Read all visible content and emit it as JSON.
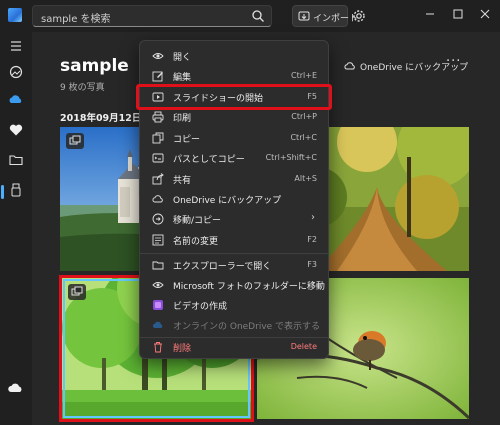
{
  "search": {
    "value": "sample を検索"
  },
  "toolbar": {
    "import_label": "インポート"
  },
  "album": {
    "title": "sample",
    "count": "9 枚の写真",
    "onedrive_label": "OneDrive にバックアップ",
    "more_label": "···",
    "date": "2018年09月12日"
  },
  "menu": {
    "items": [
      {
        "label": "開く",
        "shortcut": "",
        "icon": "eye-icon"
      },
      {
        "label": "編集",
        "shortcut": "Ctrl+E",
        "icon": "edit-icon"
      },
      {
        "label": "スライドショーの開始",
        "shortcut": "F5",
        "icon": "slideshow-icon"
      },
      {
        "label": "印刷",
        "shortcut": "Ctrl+P",
        "icon": "print-icon"
      },
      {
        "label": "コピー",
        "shortcut": "Ctrl+C",
        "icon": "copy-icon"
      },
      {
        "label": "パスとしてコピー",
        "shortcut": "Ctrl+Shift+C",
        "icon": "copy-path-icon"
      },
      {
        "label": "共有",
        "shortcut": "Alt+S",
        "icon": "share-icon"
      },
      {
        "label": "OneDrive にバックアップ",
        "shortcut": "",
        "icon": "onedrive-icon"
      },
      {
        "label": "移動/コピー",
        "shortcut": "",
        "icon": "move-icon",
        "submenu": true
      },
      {
        "label": "名前の変更",
        "shortcut": "F2",
        "icon": "rename-icon"
      },
      {
        "label": "エクスプローラーで開く",
        "shortcut": "F3",
        "icon": "explorer-icon"
      },
      {
        "label": "Microsoft フォトのフォルダーに移動",
        "shortcut": "",
        "icon": "folder-icon",
        "submenu": true
      },
      {
        "label": "ビデオの作成",
        "shortcut": "",
        "icon": "video-icon"
      },
      {
        "label": "オンラインの OneDrive で表示する",
        "shortcut": "",
        "icon": "cloud-icon",
        "disabled": true
      },
      {
        "label": "削除",
        "shortcut": "Delete",
        "icon": "trash-icon",
        "danger": true
      }
    ],
    "submenu_arrow": "›"
  },
  "colors": {
    "accent": "#4ab0ff",
    "highlight": "#e0101a",
    "menu_bg": "#2c2c2c",
    "app_bg": "#272727"
  }
}
